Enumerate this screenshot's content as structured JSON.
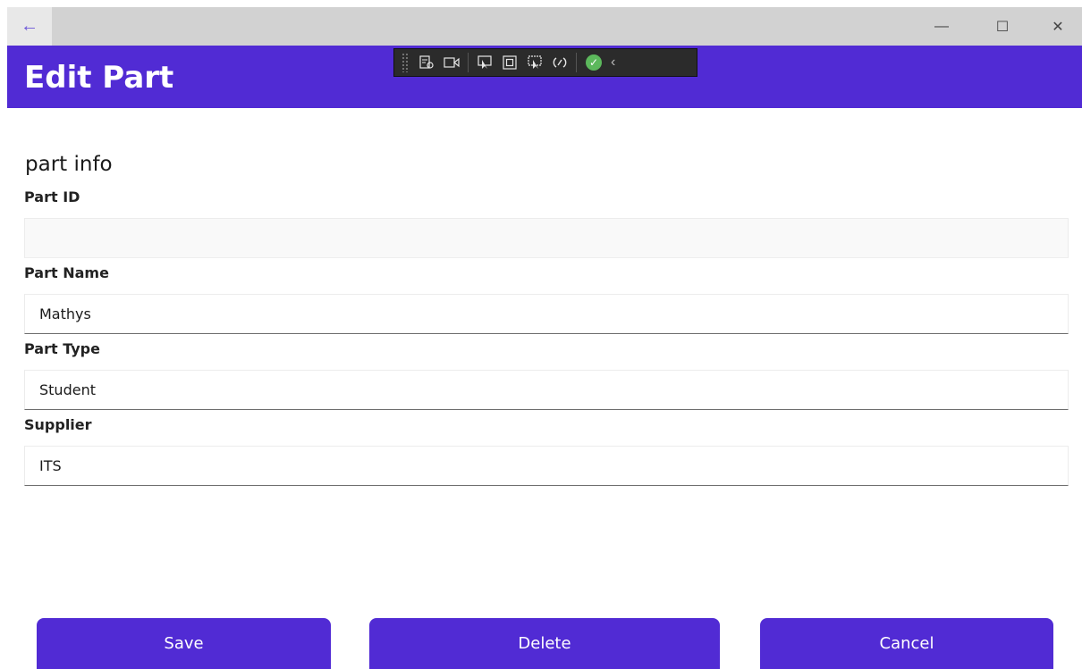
{
  "window": {
    "back_glyph": "←",
    "minimize_glyph": "—",
    "maximize_glyph": "☐",
    "close_glyph": "✕"
  },
  "header": {
    "title": "Edit Part",
    "background": "#512bd4"
  },
  "devtools_bar": {
    "icons": [
      "live-visual-tree-icon",
      "record-icon",
      "select-element-icon",
      "display-layout-adorners-icon",
      "track-focused-element-icon",
      "hot-reload-icon",
      "binding-ok-icon",
      "collapse-icon"
    ]
  },
  "form": {
    "section_title": "part info",
    "fields": [
      {
        "label": "Part ID",
        "value": "",
        "placeholder": ""
      },
      {
        "label": "Part Name",
        "value": "Mathys",
        "placeholder": ""
      },
      {
        "label": "Part Type",
        "value": "Student",
        "placeholder": ""
      },
      {
        "label": "Supplier",
        "value": "ITS",
        "placeholder": ""
      }
    ]
  },
  "actions": {
    "save_label": "Save",
    "delete_label": "Delete",
    "cancel_label": "Cancel",
    "button_color": "#512bd4"
  }
}
